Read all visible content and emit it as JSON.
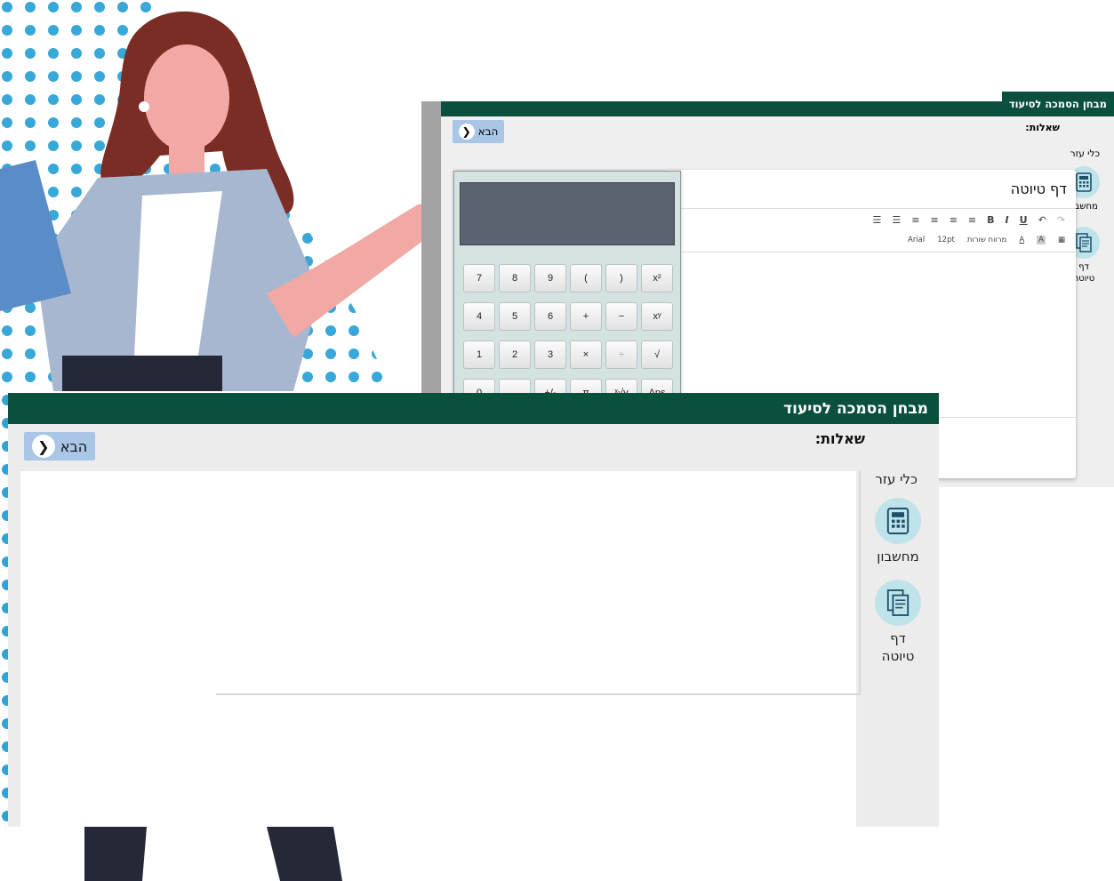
{
  "colors": {
    "header_green": "#0b4f3e",
    "button_blue": "#a9c6e6",
    "tool_circle": "#bfe3ea",
    "panel_gray": "#ececec",
    "calc_display": "#5b6270"
  },
  "front": {
    "title": "מבחן הסמכה לסיעוד",
    "next_label": "הבא",
    "questions_label": "שאלות:",
    "tools_label": "כלי עזר",
    "tools": [
      {
        "label": "מחשבון",
        "icon": "calculator-icon"
      },
      {
        "label": "דף טיוטה",
        "icon": "draft-page-icon"
      }
    ]
  },
  "back": {
    "title": "מבחן הסמכה לסיעוד",
    "next_label": "הבא",
    "questions_label": "שאלות:",
    "tools_label": "כלי עזר",
    "tools": [
      {
        "label": "מחשבון",
        "icon": "calculator-icon"
      },
      {
        "label": "דף טיוטה",
        "icon": "draft-page-icon"
      }
    ],
    "draft": {
      "title": "דף טיוטה",
      "toolbar_row1": [
        "↷",
        "↶",
        "U",
        "I",
        "B",
        "≡",
        "≡",
        "≡",
        "≡",
        "☰",
        "☰"
      ],
      "toolbar_row2": {
        "font": "Arial",
        "size": "12pt",
        "style": "מרווח שורות",
        "color_a": "A",
        "bg_a": "A"
      }
    }
  },
  "calculator": {
    "keys": [
      [
        "7",
        "8",
        "9",
        "(",
        ")",
        "x²"
      ],
      [
        "4",
        "5",
        "6",
        "+",
        "−",
        "xʸ"
      ],
      [
        "1",
        "2",
        "3",
        "×",
        "÷",
        "√"
      ],
      [
        "0",
        ".",
        "+/-",
        "π",
        "ˣ√y",
        "Ans"
      ]
    ]
  }
}
